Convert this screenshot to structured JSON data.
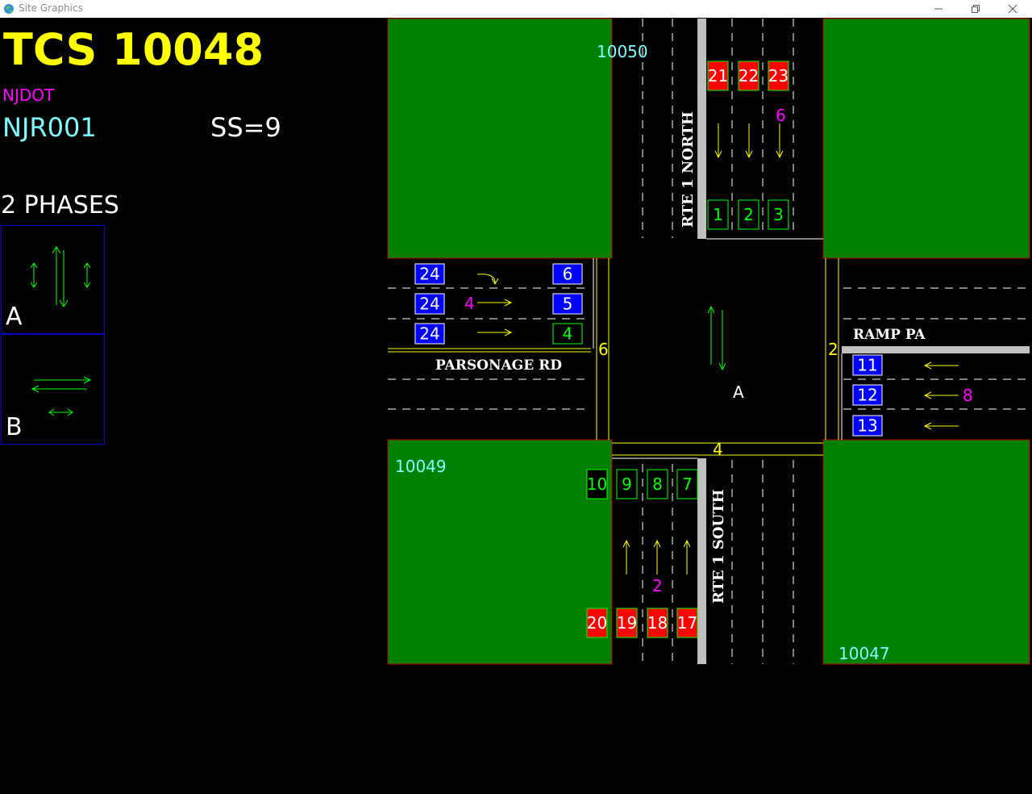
{
  "window": {
    "title": "Site Graphics"
  },
  "header": {
    "tcs_title": "TCS 10048",
    "agency": "NJDOT",
    "site_id": "NJR001",
    "ss": "SS=9",
    "phases_title": "2 PHASES"
  },
  "phases": [
    {
      "label": "A",
      "directions": "north-south"
    },
    {
      "label": "B",
      "directions": "east-west"
    }
  ],
  "map": {
    "colors": {
      "grass": "#008000",
      "background": "#000000",
      "lane_line": "#ffffff",
      "yellow": "#ffff00",
      "detector_red": "#ff0000",
      "detector_blue": "#0000ff",
      "green": "#00ff00",
      "magenta": "#ff00ff",
      "cyan": "#80ffff"
    },
    "corner_ids": {
      "nw": "10050",
      "sw": "10049",
      "se": "10047"
    },
    "roads": {
      "north": "RTE 1 NORTH",
      "south": "RTE 1 SOUTH",
      "west": "PARSONAGE RD",
      "east": "RAMP PA"
    },
    "center_phase": "A",
    "yellow_labels": {
      "west": "6",
      "east": "2",
      "south": "4"
    },
    "magenta_labels": {
      "north": "6",
      "west": "4",
      "east": "8",
      "south": "2"
    },
    "detectors": {
      "north_red": [
        "21",
        "22",
        "23"
      ],
      "north_green": [
        "1",
        "2",
        "3"
      ],
      "west_blue": [
        "24",
        "24",
        "24"
      ],
      "west_right_blue": [
        "6",
        "5"
      ],
      "west_right_green": "4",
      "east_blue": [
        "11",
        "12",
        "13"
      ],
      "south_green_black": "10",
      "south_green": [
        "9",
        "8",
        "7"
      ],
      "south_red": [
        "20",
        "19",
        "18",
        "17"
      ]
    }
  }
}
